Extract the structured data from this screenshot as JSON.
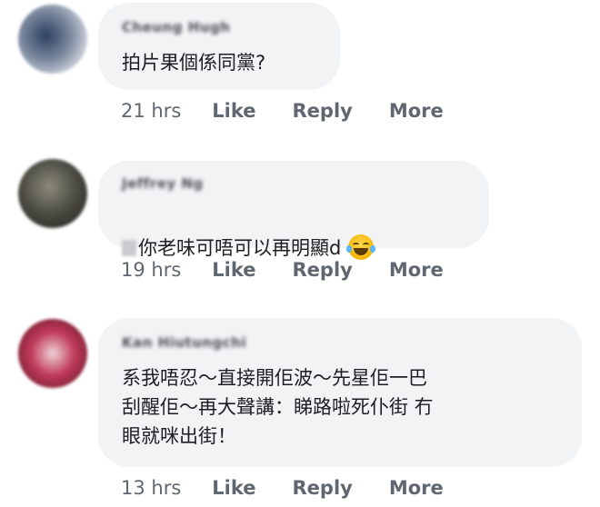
{
  "comments": [
    {
      "author": "Cheung Hugh",
      "text": "拍片果個係同黨?",
      "time": "21 hrs",
      "like": "Like",
      "reply": "Reply",
      "more": "More",
      "avatar_colors": [
        "#7d8aa0",
        "#2d4060",
        "#d9dce3"
      ]
    },
    {
      "author": "Jeffrey Ng",
      "text": "你老味可唔可以再明顯d",
      "time": "19 hrs",
      "like": "Like",
      "reply": "Reply",
      "more": "More",
      "avatar_colors": [
        "#4a4a42",
        "#8b8a7a",
        "#2a2a26"
      ]
    },
    {
      "author": "Kan Hiutungchi",
      "text": "系我唔忍～直接開佢波～先星佢一巴\n刮醒佢～再大聲講：睇路啦死仆街 冇\n眼就咪出街！",
      "time": "13 hrs",
      "like": "Like",
      "reply": "Reply",
      "more": "More",
      "avatar_colors": [
        "#c03a5a",
        "#f0d2d8",
        "#6a1a2c"
      ]
    }
  ]
}
